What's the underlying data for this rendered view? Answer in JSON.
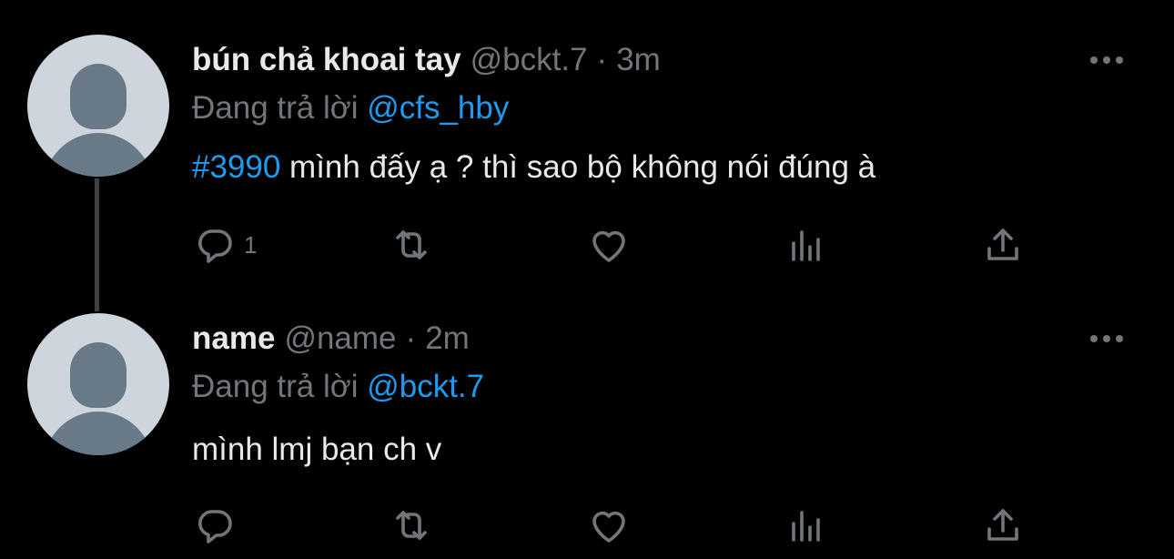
{
  "tweets": [
    {
      "display_name": "bún chả khoai tay",
      "handle": "@bckt.7",
      "separator": "·",
      "time": "3m",
      "replying_prefix": "Đang trả lời",
      "replying_to": "@cfs_hby",
      "hashtag": "#3990",
      "text": " mình đấy ạ ? thì sao bộ không nói đúng à",
      "reply_count": "1"
    },
    {
      "display_name": "name",
      "handle": "@name",
      "separator": "·",
      "time": "2m",
      "replying_prefix": "Đang trả lời",
      "replying_to": "@bckt.7",
      "hashtag": "",
      "text": "mình lmj bạn ch v",
      "reply_count": ""
    }
  ],
  "icons": {
    "more": "more-dots-icon",
    "reply": "reply-bubble-icon",
    "retweet": "retweet-arrows-icon",
    "like": "heart-icon",
    "views": "bar-chart-icon",
    "share": "share-upload-icon"
  },
  "colors": {
    "background": "#000000",
    "primary_text": "#e7e9ea",
    "secondary_text": "#71767b",
    "link": "#1d9bf0",
    "avatar_bg": "#ced5dc",
    "avatar_figure": "#687988",
    "thread_line": "#3e4144"
  }
}
